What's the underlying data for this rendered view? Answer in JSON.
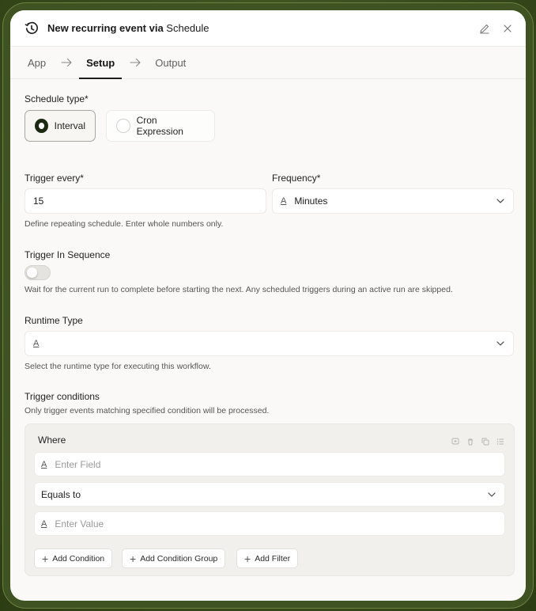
{
  "header": {
    "title_prefix": "New recurring event via",
    "title_app": "Schedule"
  },
  "steps": [
    "App",
    "Setup",
    "Output"
  ],
  "schedule_type": {
    "label": "Schedule type*",
    "options": [
      "Interval",
      "Cron Expression"
    ],
    "selected": "Interval"
  },
  "trigger_every": {
    "label": "Trigger every*",
    "value": "15",
    "help": "Define repeating schedule. Enter whole numbers only."
  },
  "frequency": {
    "label": "Frequency*",
    "icon": "A",
    "value": "Minutes"
  },
  "sequence": {
    "label": "Trigger In Sequence",
    "enabled": false,
    "help": "Wait for the current run to complete before starting the next. Any scheduled triggers during an active run are skipped."
  },
  "runtime": {
    "label": "Runtime Type",
    "icon": "A",
    "value": "",
    "help": "Select the runtime type for executing this workflow."
  },
  "conditions": {
    "label": "Trigger conditions",
    "help": "Only trigger events matching specified condition will be processed.",
    "where": "Where",
    "field_placeholder": "Enter Field",
    "operator": "Equals to",
    "value_placeholder": "Enter Value",
    "buttons": [
      "Add Condition",
      "Add Condition Group",
      "Add Filter"
    ]
  },
  "colors": {
    "accent": "#1d2a12",
    "background": "#3b4f1f"
  }
}
